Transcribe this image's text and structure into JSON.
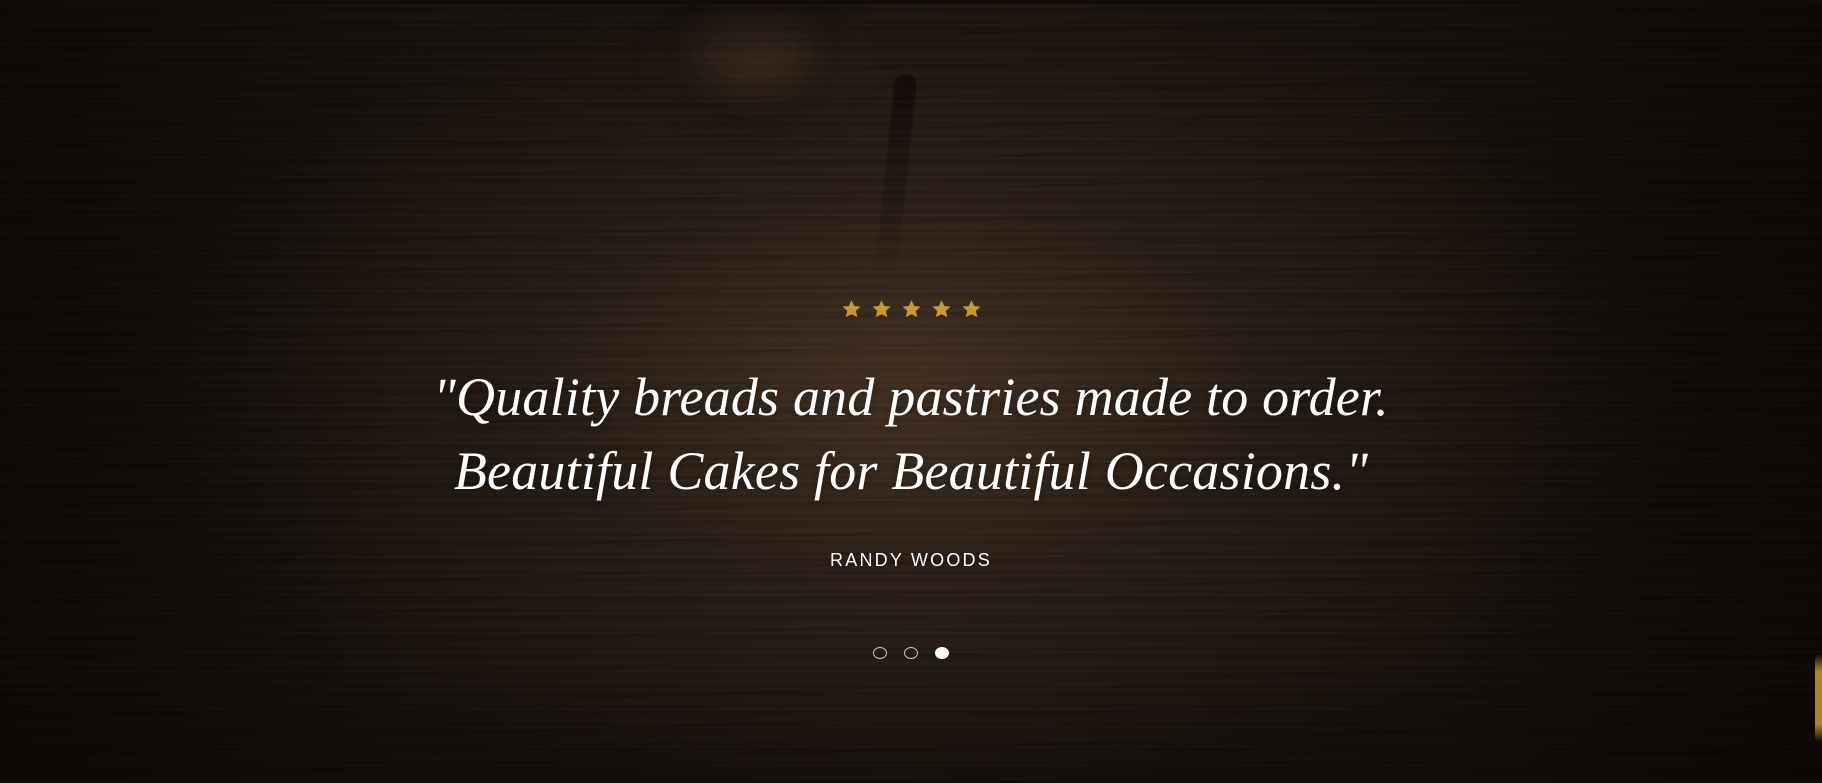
{
  "testimonial": {
    "rating": 5,
    "rating_max": 5,
    "quote_lines": [
      "\"Quality breads and pastries made to order.",
      "Beautiful Cakes for Beautiful Occasions.\""
    ],
    "author": "RANDY WOODS"
  },
  "carousel": {
    "current_slide": 3,
    "total_slides": 3
  },
  "icons": {
    "star": "star-icon"
  },
  "colors": {
    "star_gold": "#C79A2F",
    "text": "#FFFFFF",
    "accent": "#C69A30"
  }
}
